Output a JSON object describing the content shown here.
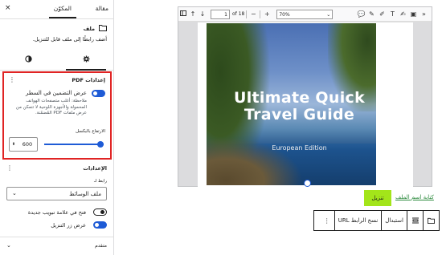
{
  "sidebar": {
    "tabs": {
      "post": "مقالة",
      "block": "المكوّن"
    },
    "close_icon": "×",
    "file_block": {
      "title": "ملف",
      "description": "أضف رابطًا إلى ملف قابل للتنزيل."
    },
    "style_tabs": {
      "settings_icon": "gear-icon",
      "styles_icon": "half-circle-icon"
    },
    "pdf_settings": {
      "title": "إعدادات PDF",
      "inline_embed_label": "عرض التضمين في السطر",
      "inline_embed_enabled": true,
      "inline_embed_help": "ملاحظة: أغلب متصفحات الهواتف المحمولة والأجهزة اللوحية لا تتمكن من عرض ملفات PDF المُضمّنة.",
      "height_label": "الارتفاع بالبكسل",
      "height_value": "600",
      "height_fraction": 0.5
    },
    "settings": {
      "title": "الإعدادات",
      "link_to_label": "رابط لـ",
      "link_to_value": "ملف الوسائط",
      "new_tab_label": "فتح في علامة تبويب جديدة",
      "new_tab_enabled": false,
      "download_button_label": "عرض زر التنزيل",
      "download_button_enabled": true
    },
    "advanced_label": "متقدم"
  },
  "viewer": {
    "page_number": "1",
    "page_of": "of 18",
    "zoom": "70%",
    "cover_title": "Ultimate Quick Travel Guide",
    "cover_subtitle": "European Edition"
  },
  "download_button_label": "تنزيل",
  "file_link_text": "كتابة اسم الملف",
  "block_toolbar": {
    "replace_label": "استبدال",
    "copy_url_label": "نسخ الرابط URL"
  },
  "colors": {
    "accent": "#1e5bd6",
    "highlight": "#e02424",
    "download_bg": "#a3e51a",
    "link": "#2c8a3d"
  }
}
